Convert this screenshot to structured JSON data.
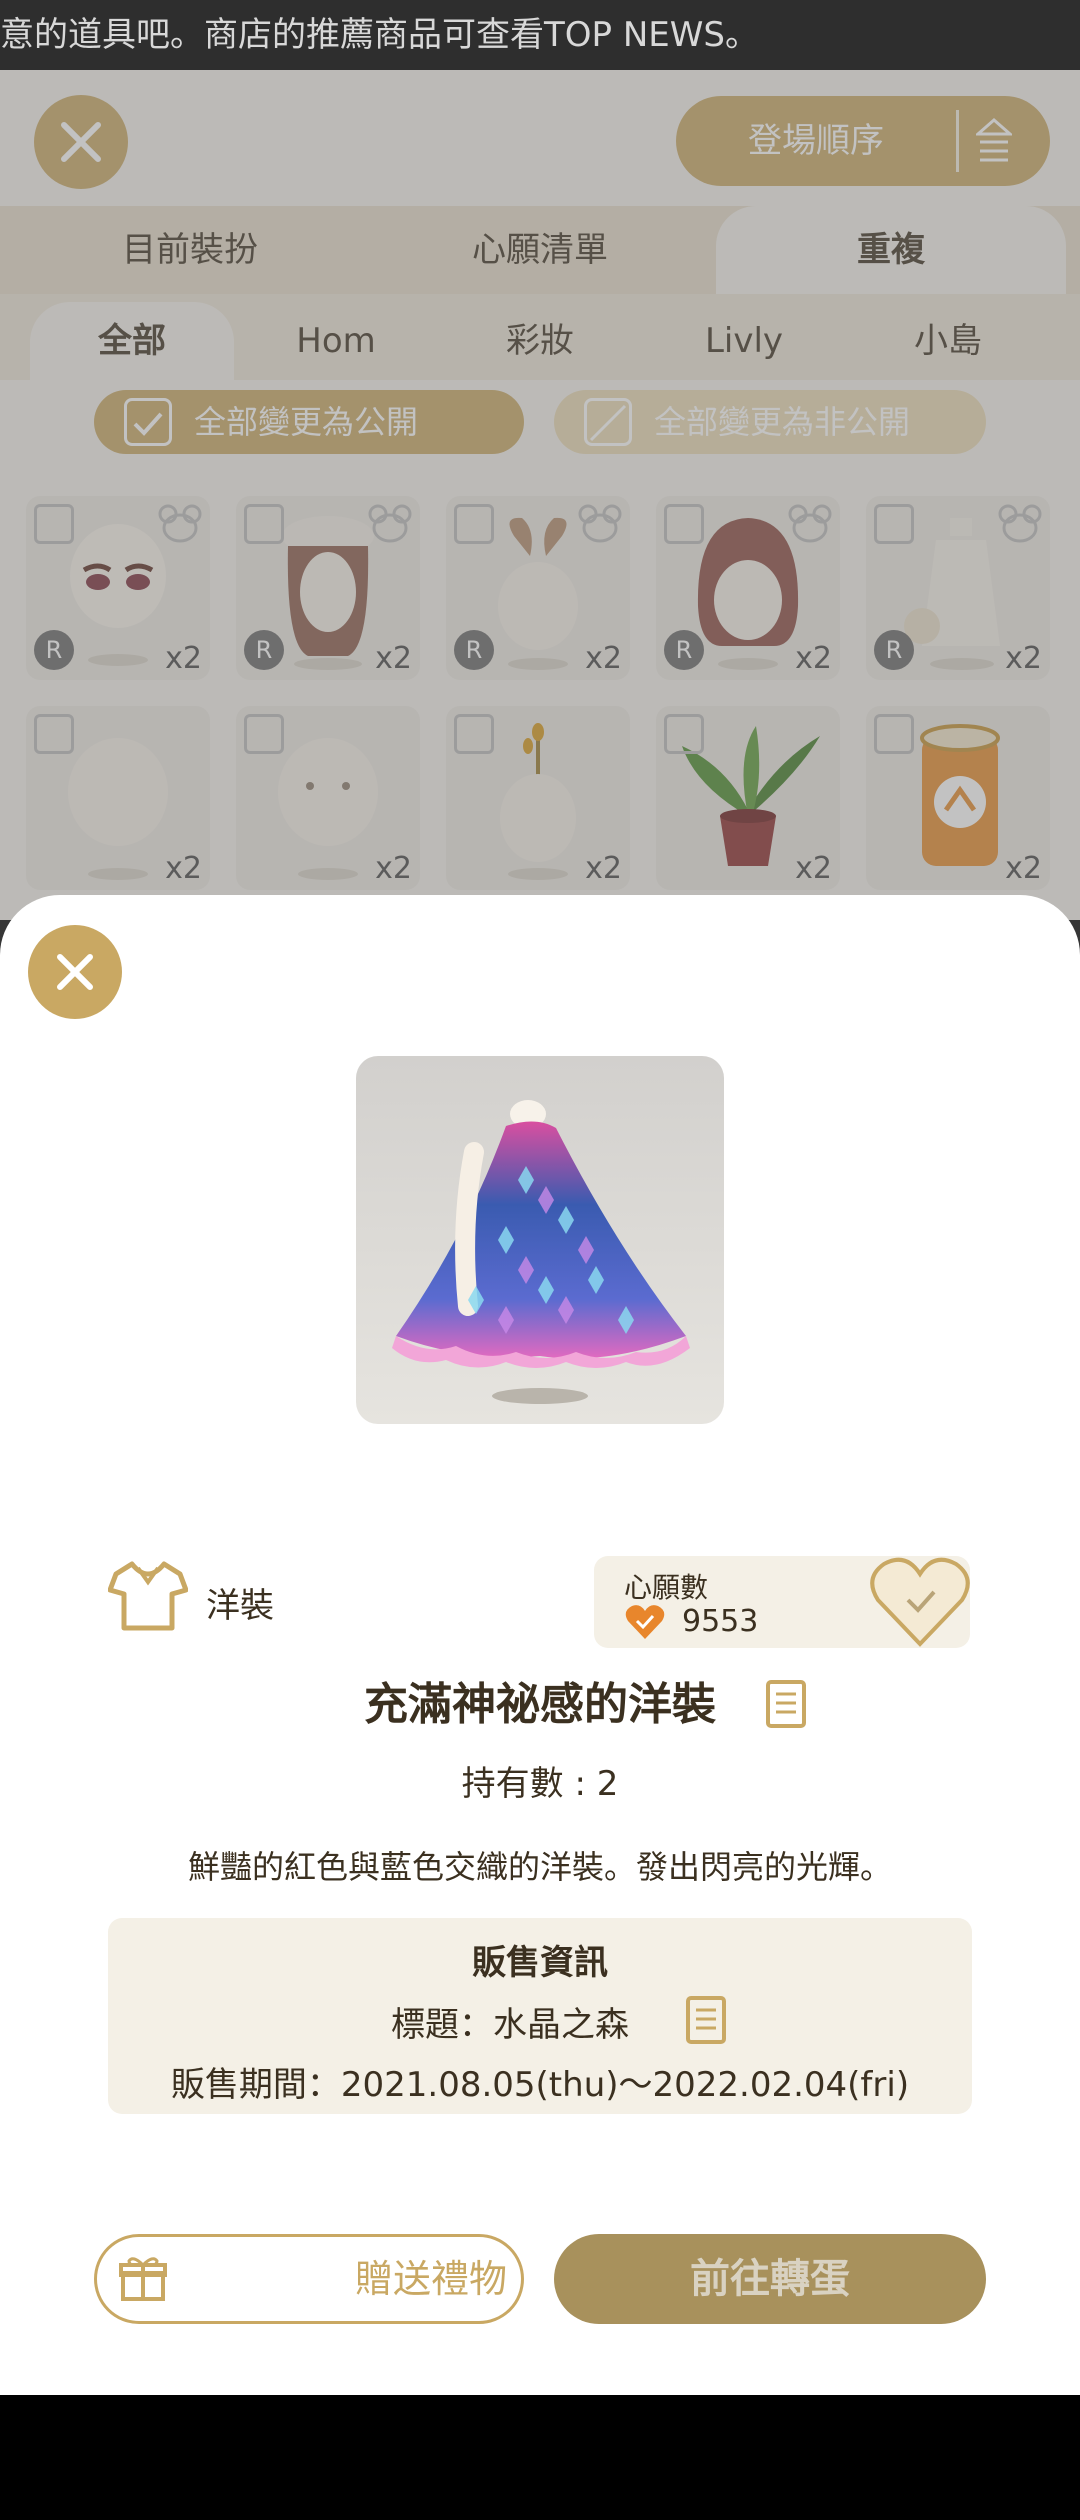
{
  "ticker": {
    "text": "意的道具吧。商店的推薦商品可查看TOP NEWS。"
  },
  "header": {
    "sort_label": "登場順序"
  },
  "tabs": [
    {
      "label": "目前裝扮"
    },
    {
      "label": "心願清單"
    },
    {
      "label": "重複"
    }
  ],
  "subtabs": [
    {
      "label": "全部"
    },
    {
      "label": "Hom"
    },
    {
      "label": "彩妝"
    },
    {
      "label": "Livly"
    },
    {
      "label": "小島"
    }
  ],
  "visibility": {
    "public_label": "全部變更為公開",
    "private_label": "全部變更為非公開"
  },
  "grid": {
    "rows": [
      [
        {
          "count": "x2",
          "badge": "R"
        },
        {
          "count": "x2",
          "badge": "R"
        },
        {
          "count": "x2",
          "badge": "R"
        },
        {
          "count": "x2",
          "badge": "R"
        },
        {
          "count": "x2",
          "badge": "R"
        }
      ],
      [
        {
          "count": "x2"
        },
        {
          "count": "x2"
        },
        {
          "count": "x2"
        },
        {
          "count": "x2"
        },
        {
          "count": "x2"
        }
      ]
    ]
  },
  "detail": {
    "category": "洋裝",
    "wish_title": "心願數",
    "wish_count": "9553",
    "name": "充滿神祕感的洋裝",
    "owned": "持有數 : 2",
    "description": "鮮豔的紅色與藍色交織的洋裝。發出閃亮的光輝。",
    "sale": {
      "title": "販售資訊",
      "label": "標題：水晶之森",
      "period": "販售期間：2021.08.05(thu)～2022.02.04(fri)"
    },
    "gift_button": "贈送禮物",
    "gacha_button": "前往轉蛋"
  },
  "colors": {
    "gold": "#c9a863",
    "text": "#3b3020",
    "accent_heart": "#e8862c"
  }
}
